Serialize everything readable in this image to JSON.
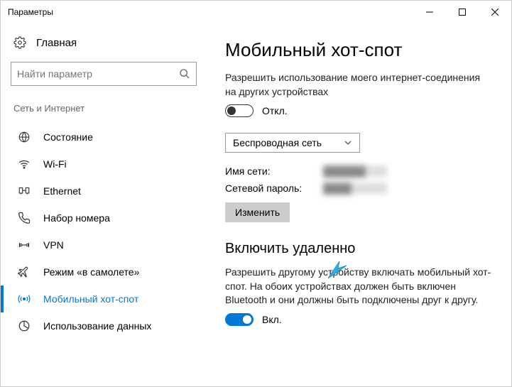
{
  "window": {
    "title": "Параметры"
  },
  "sidebar": {
    "home": "Главная",
    "search_placeholder": "Найти параметр",
    "category": "Сеть и Интернет",
    "items": [
      {
        "label": "Состояние",
        "icon": "status-icon"
      },
      {
        "label": "Wi-Fi",
        "icon": "wifi-icon"
      },
      {
        "label": "Ethernet",
        "icon": "ethernet-icon"
      },
      {
        "label": "Набор номера",
        "icon": "dialup-icon"
      },
      {
        "label": "VPN",
        "icon": "vpn-icon"
      },
      {
        "label": "Режим «в самолете»",
        "icon": "airplane-icon"
      },
      {
        "label": "Мобильный хот-спот",
        "icon": "hotspot-icon",
        "active": true
      },
      {
        "label": "Использование данных",
        "icon": "datausage-icon"
      }
    ]
  },
  "main": {
    "heading": "Мобильный хот-спот",
    "share_desc": "Разрешить использование моего интернет-соединения на других устройствах",
    "share_toggle_state": "Откл.",
    "select_value": "Беспроводная сеть",
    "network_name_label": "Имя сети:",
    "network_name_value": "██████",
    "password_label": "Сетевой пароль:",
    "password_value": "████",
    "edit_button": "Изменить",
    "remote_heading": "Включить удаленно",
    "remote_desc": "Разрешить другому устройству включать мобильный хот-спот. На обоих устройствах должен быть включен Bluetooth и они должны быть подключены друг к другу.",
    "remote_toggle_state": "Вкл."
  }
}
